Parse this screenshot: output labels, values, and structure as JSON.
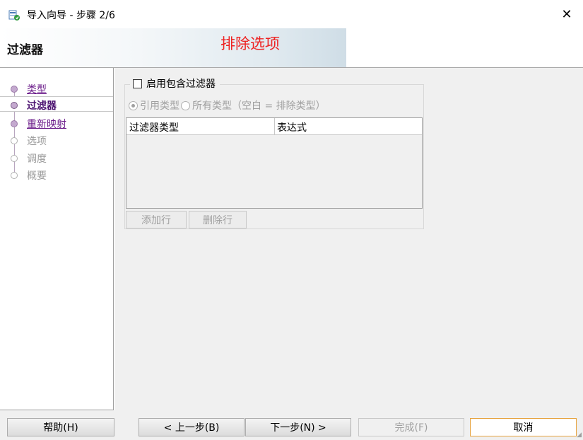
{
  "window": {
    "title": "导入向导 - 步骤 2/6",
    "close_glyph": "✕",
    "icon": "wizard-app-icon"
  },
  "header": {
    "page_title": "过滤器",
    "annotation": "排除选项",
    "annotation_color": "#ee2222"
  },
  "steps": [
    {
      "label": "类型",
      "state": "visited"
    },
    {
      "label": "过滤器",
      "state": "current"
    },
    {
      "label": "重新映射",
      "state": "visited"
    },
    {
      "label": "选项",
      "state": "future"
    },
    {
      "label": "调度",
      "state": "future"
    },
    {
      "label": "概要",
      "state": "future"
    }
  ],
  "filters": {
    "enable_label": "启用包含过滤器",
    "enable_checked": false,
    "radio_referenced": "引用类型",
    "radio_all": "所有类型（空白 = 排除类型）",
    "radio_selected": "引用类型",
    "table_headers": [
      "过滤器类型",
      "表达式"
    ],
    "rows": [],
    "add_row_label": "添加行",
    "delete_row_label": "删除行"
  },
  "footer": {
    "help_label": "帮助(H)",
    "back_label": "< 上一步(B)",
    "next_label": "下一步(N) >",
    "finish_label": "完成(F)",
    "cancel_label": "取消"
  }
}
